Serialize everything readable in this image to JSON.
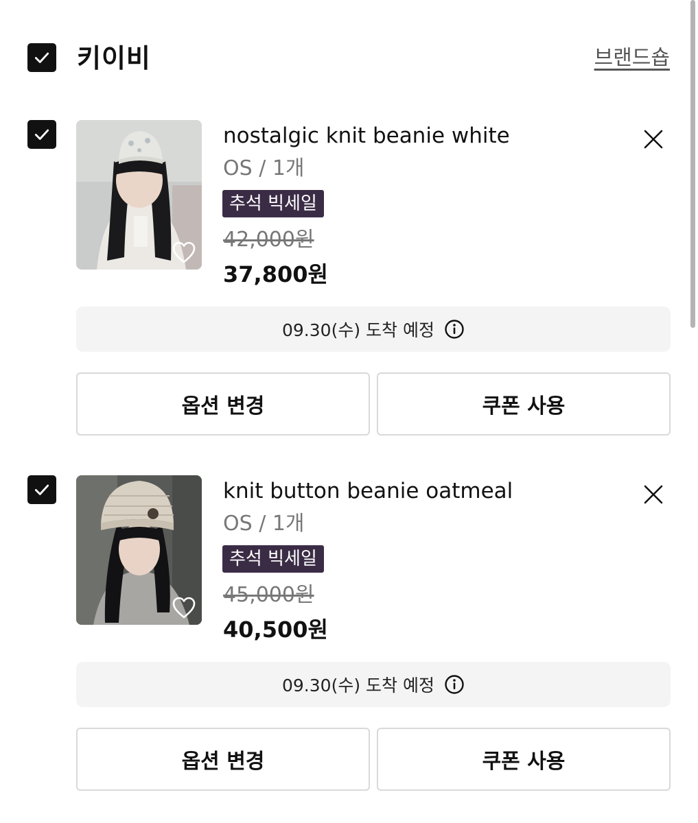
{
  "brand": {
    "name": "키이비",
    "shop_link": "브랜드숍"
  },
  "items": [
    {
      "name": "nostalgic knit beanie white",
      "option": "OS / 1개",
      "badge": "추석 빅세일",
      "original_price": "42,000원",
      "sale_price": "37,800원",
      "delivery": "09.30(수) 도착 예정",
      "option_button": "옵션 변경",
      "coupon_button": "쿠폰 사용"
    },
    {
      "name": "knit button beanie oatmeal",
      "option": "OS / 1개",
      "badge": "추석 빅세일",
      "original_price": "45,000원",
      "sale_price": "40,500원",
      "delivery": "09.30(수) 도착 예정",
      "option_button": "옵션 변경",
      "coupon_button": "쿠폰 사용"
    }
  ],
  "icons": {
    "checkbox": "checkmark-icon",
    "close": "close-icon",
    "wishlist": "heart-icon",
    "info": "info-icon"
  },
  "colors": {
    "badge_bg": "#3b2c46",
    "checkbox_bg": "#111111",
    "delivery_bg": "#f4f4f4",
    "button_border": "#d9d9d9"
  }
}
